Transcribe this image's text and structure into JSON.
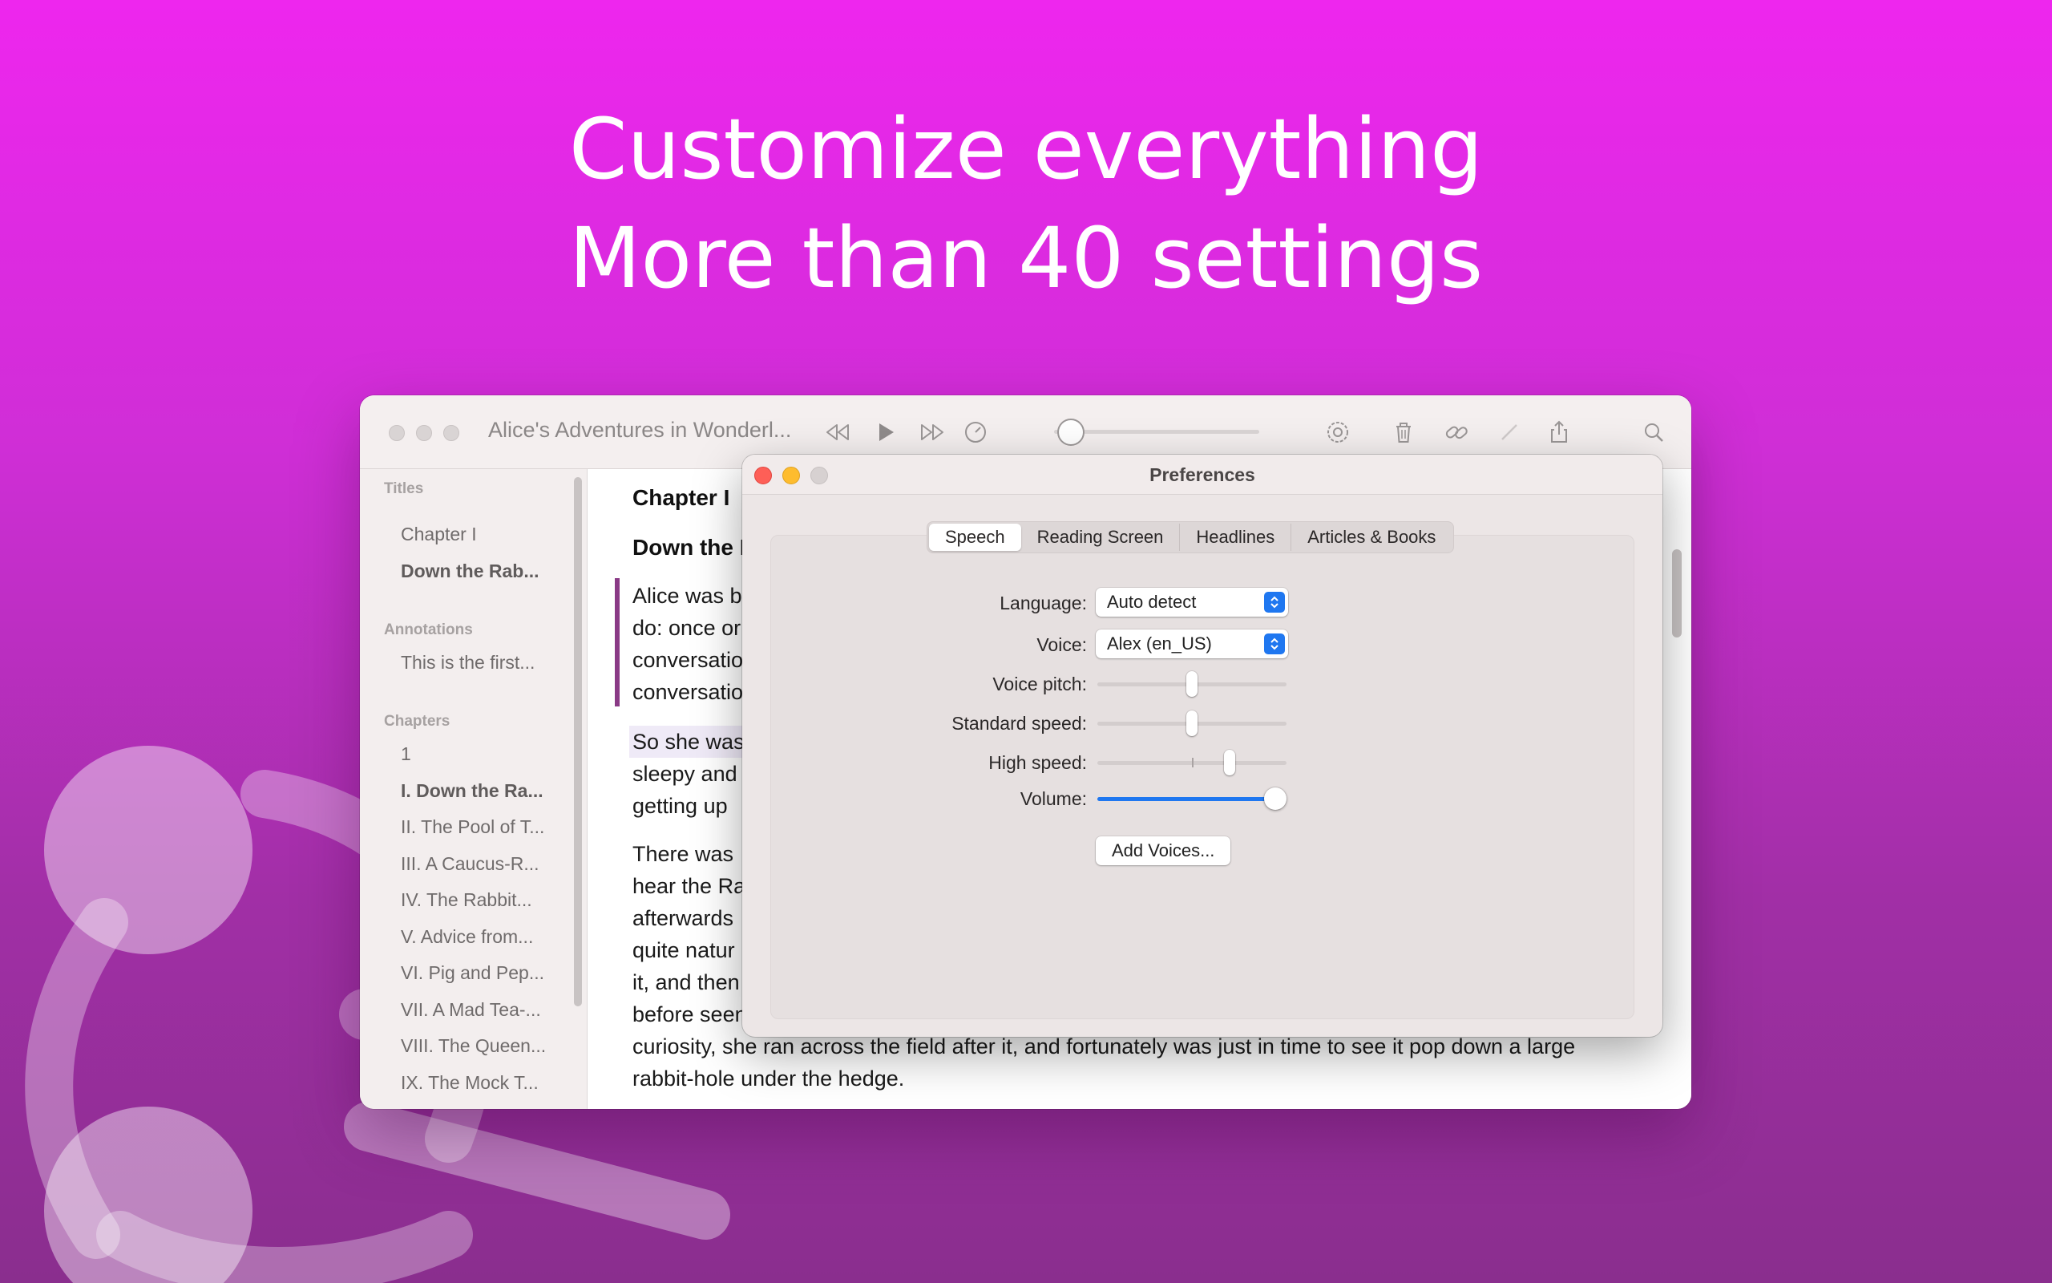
{
  "colors": {
    "background_top": "#ee26ee",
    "background_bottom": "#8a2e8e",
    "accent": "#1f77f0",
    "quote_bar": "#8a3a86"
  },
  "headline": {
    "line1": "Customize everything",
    "line2": "More than 40 settings"
  },
  "window": {
    "title": "Alice's Adventures in Wonderl...",
    "toolbar_icons": [
      "rewind-icon",
      "play-icon",
      "fast-forward-icon",
      "speed-icon",
      "settings-icon",
      "trash-icon",
      "link-icon",
      "pencil-icon",
      "share-icon",
      "search-icon"
    ],
    "sidebar": {
      "titles_heading": "Titles",
      "titles": [
        "Chapter I",
        "Down the Rab..."
      ],
      "annotations_heading": "Annotations",
      "annotations": [
        "This is the first..."
      ],
      "chapters_heading": "Chapters",
      "chapters": [
        "1",
        "I. Down the Ra...",
        "II. The Pool of T...",
        "III. A Caucus-R...",
        "IV. The Rabbit...",
        "V. Advice from...",
        "VI. Pig and Pep...",
        "VII. A Mad Tea-...",
        "VIII. The Queen...",
        "IX. The Mock T..."
      ]
    },
    "content": {
      "chapter_title": "Chapter I",
      "subtitle": "Down the R",
      "para1": [
        "Alice was b",
        "do: once or",
        "conversatio",
        "conversatio"
      ],
      "para2": [
        "So she was",
        "sleepy and",
        "getting up"
      ],
      "para3": [
        "There was",
        "hear the Ra",
        "afterwards",
        "quite natur",
        "it, and then",
        "before seen",
        "curiosity, she ran across the field after it, and fortunately was just in time to see it pop down a large",
        "rabbit-hole under the hedge."
      ]
    }
  },
  "prefs": {
    "title": "Preferences",
    "tabs": [
      "Speech",
      "Reading Screen",
      "Headlines",
      "Articles & Books"
    ],
    "active_tab": "Speech",
    "language_label": "Language:",
    "language_value": "Auto detect",
    "voice_label": "Voice:",
    "voice_value": "Alex (en_US)",
    "voice_pitch_label": "Voice pitch:",
    "voice_pitch": 0.5,
    "standard_speed_label": "Standard speed:",
    "standard_speed": 0.5,
    "high_speed_label": "High speed:",
    "high_speed": 0.7,
    "volume_label": "Volume:",
    "volume": 0.94,
    "add_voices_label": "Add Voices..."
  }
}
